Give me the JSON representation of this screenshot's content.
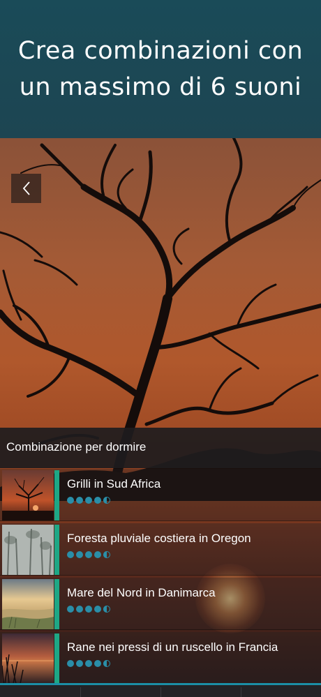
{
  "header": {
    "title": "Crea combinazioni con un massimo di 6 suoni"
  },
  "navigation": {
    "back_icon": "chevron-left-icon"
  },
  "mix": {
    "title": "Combinazione per dormire",
    "sounds": [
      {
        "name": "Grilli in Sud Africa",
        "rating": 4.5,
        "thumb_icon": "savanna-sunset-thumbnail"
      },
      {
        "name": "Foresta pluviale costiera in Oregon",
        "rating": 4.5,
        "thumb_icon": "misty-forest-thumbnail"
      },
      {
        "name": "Mare del Nord in Danimarca",
        "rating": 4.5,
        "thumb_icon": "dune-beach-thumbnail"
      },
      {
        "name": "Rane nei pressi di un ruscello in Francia",
        "rating": 4.5,
        "thumb_icon": "pond-sunset-thumbnail"
      }
    ]
  },
  "colors": {
    "header_bg": "#1a4b58",
    "accent": "#1ea785",
    "rating_dot": "#2a8ea8"
  }
}
